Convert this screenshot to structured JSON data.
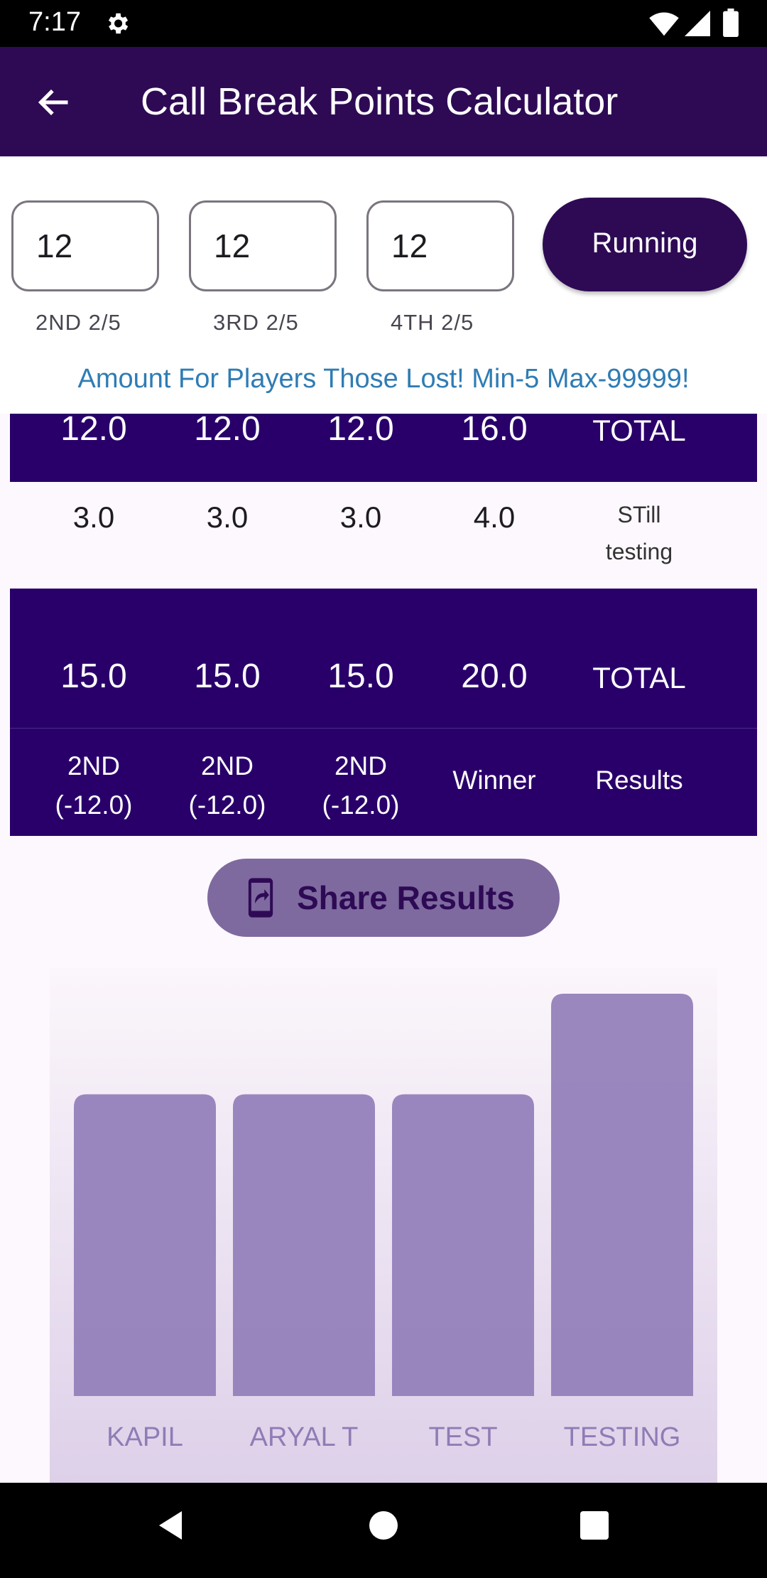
{
  "status": {
    "time": "7:17"
  },
  "app_bar": {
    "title": "Call Break Points Calculator"
  },
  "inputs": [
    {
      "value": "12",
      "caption": "2ND   2/5"
    },
    {
      "value": "12",
      "caption": "3RD   2/5"
    },
    {
      "value": "12",
      "caption": "4TH   2/5"
    }
  ],
  "running_label": "Running",
  "amount_note": "Amount For Players Those Lost! Min-5 Max-99999!",
  "table1": {
    "totals": [
      "12.0",
      "12.0",
      "12.0",
      "16.0"
    ],
    "totals_label": "TOTAL",
    "round": [
      "3.0",
      "3.0",
      "3.0",
      "4.0"
    ],
    "round_label": "STill testing"
  },
  "table2": {
    "totals": [
      "15.0",
      "15.0",
      "15.0",
      "20.0"
    ],
    "totals_label": "TOTAL",
    "results": [
      "2ND (-12.0)",
      "2ND (-12.0)",
      "2ND (-12.0)",
      "Winner"
    ],
    "results_label": "Results"
  },
  "share_label": "Share Results",
  "chart_data": {
    "type": "bar",
    "categories": [
      "KAPIL",
      "ARYAL T",
      "TEST",
      "TESTING"
    ],
    "values": [
      15,
      15,
      15,
      20
    ],
    "ylim": [
      0,
      20
    ],
    "grid": false,
    "bar_color": "#9581bb"
  },
  "colors": {
    "primary": "#2e0a55",
    "table_bg": "#29006a",
    "note": "#2f7cb4",
    "share_bg": "#7e6a9f"
  }
}
